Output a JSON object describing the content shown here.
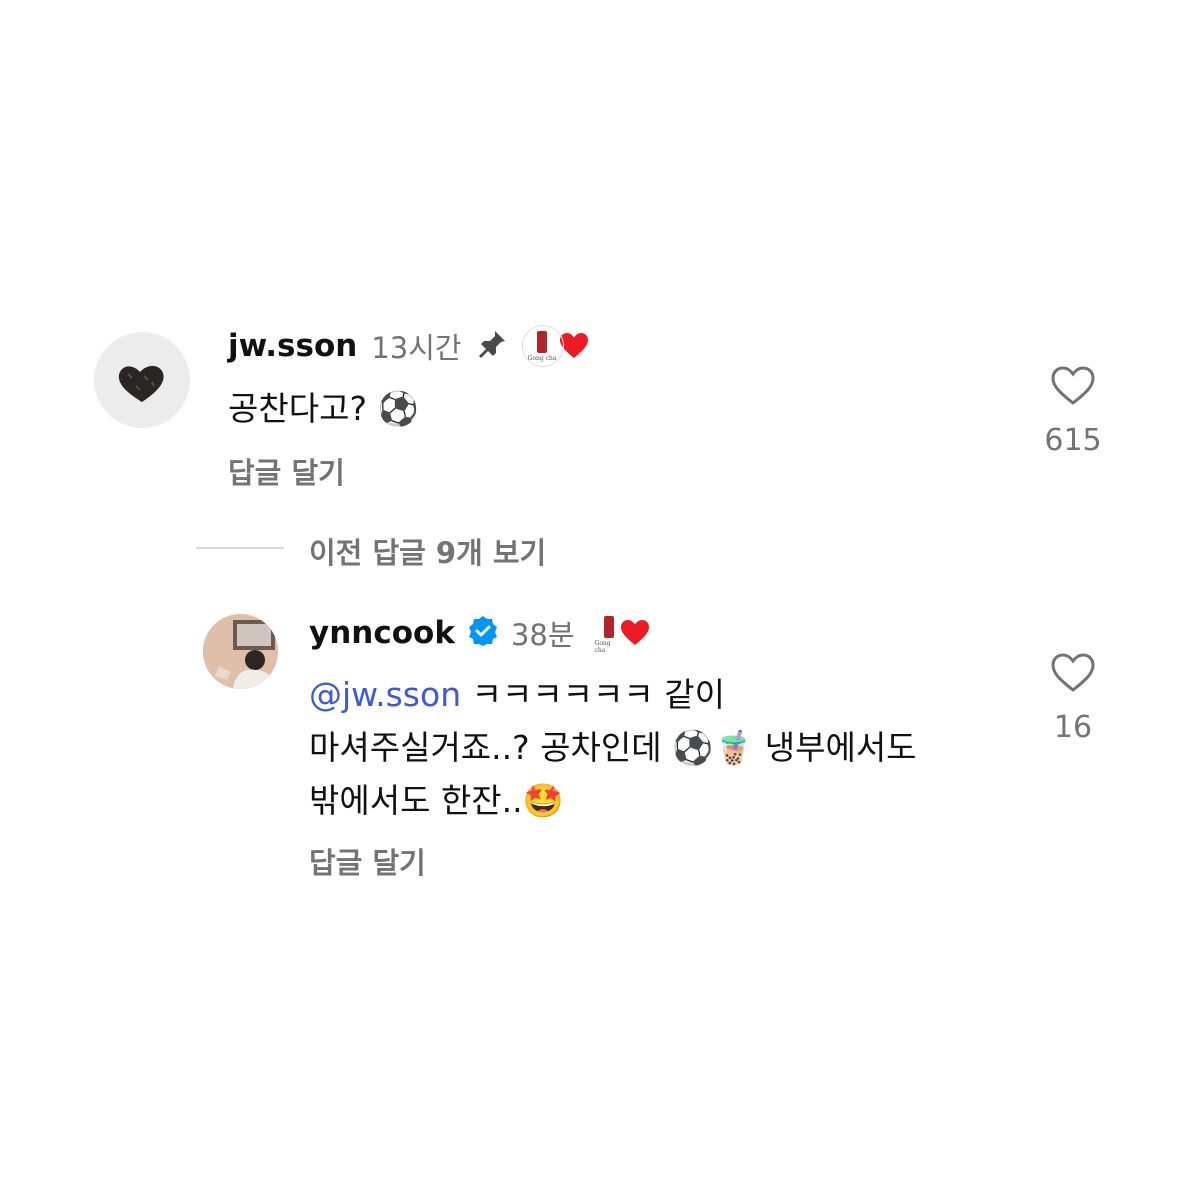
{
  "comments": [
    {
      "username": "jw.sson",
      "time": "13시간",
      "pin_icon": "pin-icon",
      "text": "공찬다고? ⚽",
      "reply_label": "답글 달기",
      "like_count": "615"
    },
    {
      "username": "ynncook",
      "verified_icon": "verified-badge-icon",
      "time": "38분",
      "mention": "@jw.sson",
      "text_line1": " ㅋㅋㅋㅋㅋㅋ 같이",
      "text_line2": "마셔주실거죠..? 공차인데 ⚽🧋 냉부에서도",
      "text_line3": "밖에서도 한잔..🤩",
      "reply_label": "답글 달기",
      "like_count": "16"
    }
  ],
  "view_replies_label": "이전 답글 9개 보기",
  "brand_logo_text": "Gong cha",
  "colors": {
    "background": "#ffffff",
    "username": "#111111",
    "meta_gray": "#737373",
    "mention_blue": "#3f58d8",
    "verified_blue": "#0095f6",
    "heart_red": "#ed1c24",
    "gongcha_red": "#b3252c"
  }
}
